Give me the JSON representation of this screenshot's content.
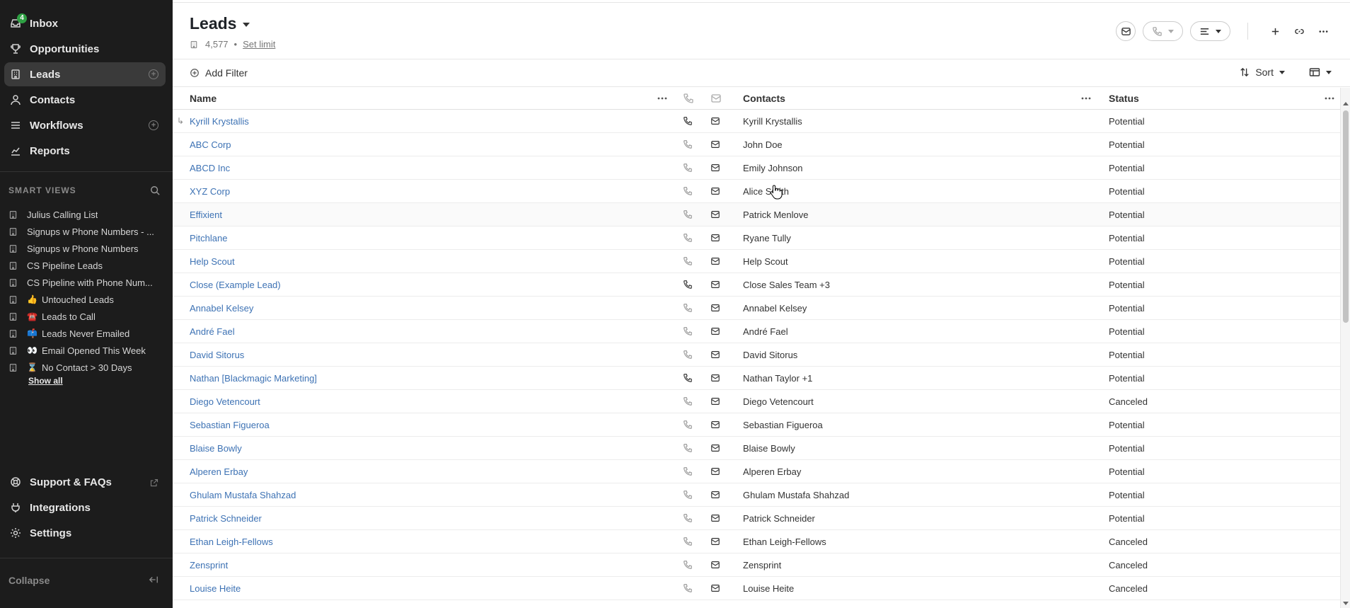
{
  "sidebar": {
    "inbox_badge": "4",
    "nav": [
      {
        "label": "Inbox"
      },
      {
        "label": "Opportunities"
      },
      {
        "label": "Leads"
      },
      {
        "label": "Contacts"
      },
      {
        "label": "Workflows"
      },
      {
        "label": "Reports"
      }
    ],
    "smart_views_title": "SMART VIEWS",
    "smart_views": [
      {
        "emoji": "",
        "label": "Julius Calling List"
      },
      {
        "emoji": "",
        "label": "Signups w Phone Numbers - ..."
      },
      {
        "emoji": "",
        "label": "Signups w Phone Numbers"
      },
      {
        "emoji": "",
        "label": "CS Pipeline Leads"
      },
      {
        "emoji": "",
        "label": "CS Pipeline with Phone Num..."
      },
      {
        "emoji": "👍",
        "label": "Untouched Leads"
      },
      {
        "emoji": "☎️",
        "label": "Leads to Call"
      },
      {
        "emoji": "📫",
        "label": "Leads Never Emailed"
      },
      {
        "emoji": "👀",
        "label": "Email Opened This Week"
      },
      {
        "emoji": "⌛",
        "label": "No Contact > 30 Days"
      }
    ],
    "show_all": "Show all",
    "bottom_nav": [
      {
        "label": "Support & FAQs"
      },
      {
        "label": "Integrations"
      },
      {
        "label": "Settings"
      }
    ],
    "collapse": "Collapse"
  },
  "header": {
    "title": "Leads",
    "count": "4,577",
    "separator": "•",
    "set_limit": "Set limit"
  },
  "toolbar": {
    "add_filter": "Add Filter",
    "sort": "Sort"
  },
  "table": {
    "columns": {
      "name": "Name",
      "contacts": "Contacts",
      "status": "Status"
    },
    "rows": [
      {
        "name": "Kyrill Krystallis",
        "contact": "Kyrill Krystallis",
        "status": "Potential",
        "phone": true,
        "sub": true
      },
      {
        "name": "ABC Corp",
        "contact": "John Doe",
        "status": "Potential",
        "phone": false,
        "sub": false
      },
      {
        "name": "ABCD Inc",
        "contact": "Emily Johnson",
        "status": "Potential",
        "phone": false,
        "sub": false
      },
      {
        "name": "XYZ Corp",
        "contact": "Alice Smith",
        "status": "Potential",
        "phone": false,
        "sub": false
      },
      {
        "name": "Effixient",
        "contact": "Patrick Menlove",
        "status": "Potential",
        "phone": false,
        "sub": false
      },
      {
        "name": "Pitchlane",
        "contact": "Ryane Tully",
        "status": "Potential",
        "phone": false,
        "sub": false
      },
      {
        "name": "Help Scout",
        "contact": "Help Scout",
        "status": "Potential",
        "phone": false,
        "sub": false
      },
      {
        "name": "Close (Example Lead)",
        "contact": "Close Sales Team +3",
        "status": "Potential",
        "phone": true,
        "sub": false
      },
      {
        "name": "Annabel Kelsey",
        "contact": "Annabel Kelsey",
        "status": "Potential",
        "phone": false,
        "sub": false
      },
      {
        "name": "André Fael",
        "contact": "André Fael",
        "status": "Potential",
        "phone": false,
        "sub": false
      },
      {
        "name": "David Sitorus",
        "contact": "David Sitorus",
        "status": "Potential",
        "phone": false,
        "sub": false
      },
      {
        "name": "Nathan [Blackmagic Marketing]",
        "contact": "Nathan Taylor +1",
        "status": "Potential",
        "phone": true,
        "sub": false
      },
      {
        "name": "Diego Vetencourt",
        "contact": "Diego Vetencourt",
        "status": "Canceled",
        "phone": false,
        "sub": false
      },
      {
        "name": "Sebastian Figueroa",
        "contact": "Sebastian Figueroa",
        "status": "Potential",
        "phone": false,
        "sub": false
      },
      {
        "name": "Blaise Bowly",
        "contact": "Blaise Bowly",
        "status": "Potential",
        "phone": false,
        "sub": false
      },
      {
        "name": "Alperen Erbay",
        "contact": "Alperen Erbay",
        "status": "Potential",
        "phone": false,
        "sub": false
      },
      {
        "name": "Ghulam Mustafa Shahzad",
        "contact": "Ghulam Mustafa Shahzad",
        "status": "Potential",
        "phone": false,
        "sub": false
      },
      {
        "name": "Patrick Schneider",
        "contact": "Patrick Schneider",
        "status": "Potential",
        "phone": false,
        "sub": false
      },
      {
        "name": "Ethan Leigh-Fellows",
        "contact": "Ethan Leigh-Fellows",
        "status": "Canceled",
        "phone": false,
        "sub": false
      },
      {
        "name": "Zensprint",
        "contact": "Zensprint",
        "status": "Canceled",
        "phone": false,
        "sub": false
      },
      {
        "name": "Louise Heite",
        "contact": "Louise Heite",
        "status": "Canceled",
        "phone": false,
        "sub": false
      }
    ]
  },
  "colors": {
    "sidebar_bg": "#1c1c1c",
    "link": "#3d72b4",
    "badge": "#2ea043"
  }
}
